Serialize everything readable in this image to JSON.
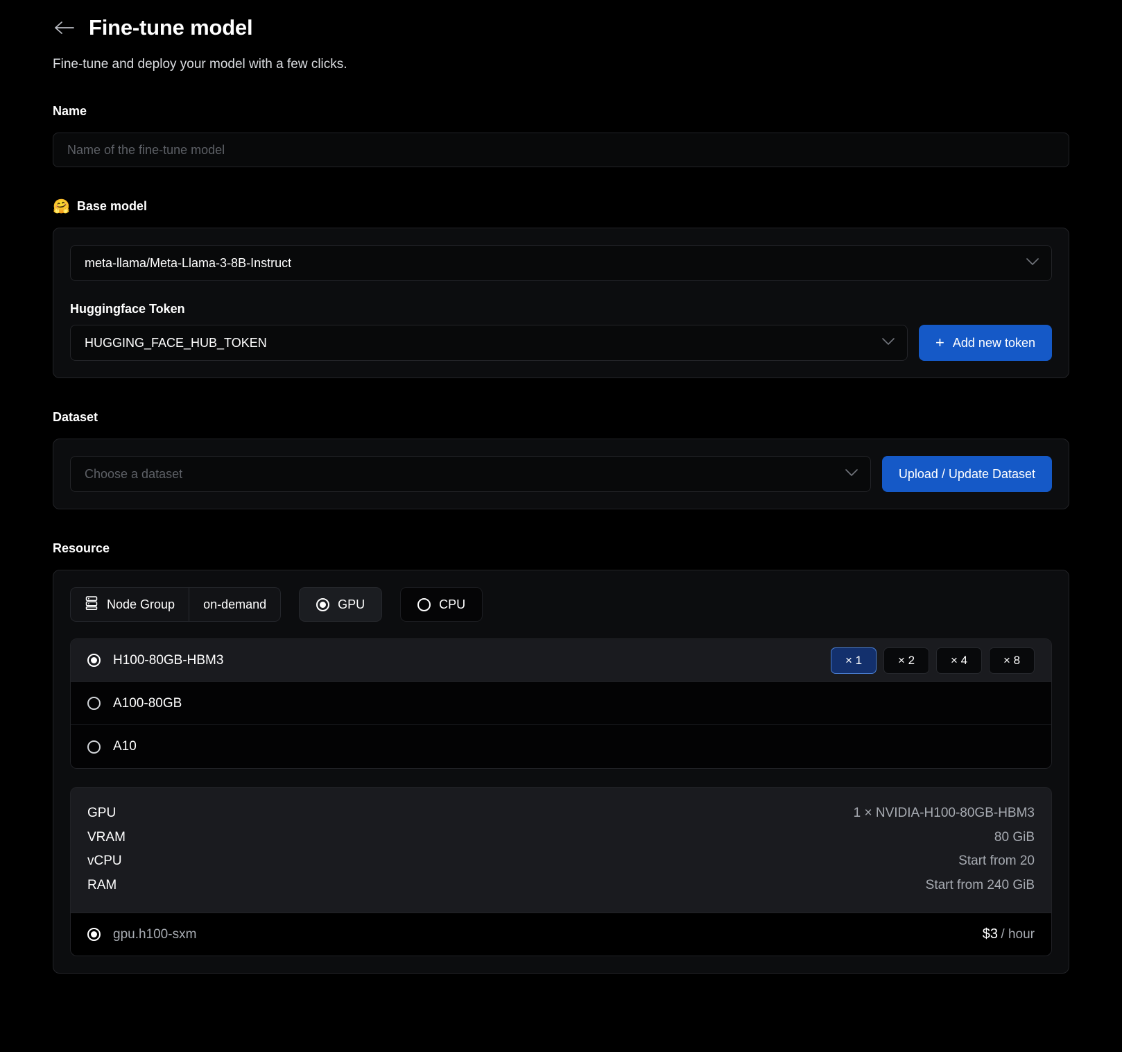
{
  "header": {
    "back_icon": "arrow-left-icon",
    "title": "Fine-tune model",
    "subtitle": "Fine-tune and deploy your model with a few clicks."
  },
  "name_section": {
    "label": "Name",
    "placeholder": "Name of the fine-tune model",
    "value": ""
  },
  "base_model": {
    "emoji": "🤗",
    "label": "Base model",
    "model_select": {
      "value": "meta-llama/Meta-Llama-3-8B-Instruct",
      "chevron": "chevron-down-icon"
    },
    "token": {
      "label": "Huggingface Token",
      "value": "HUGGING_FACE_HUB_TOKEN",
      "chevron": "chevron-down-icon",
      "add_button": "Add new token",
      "add_button_icon": "plus-icon"
    }
  },
  "dataset": {
    "label": "Dataset",
    "select_placeholder": "Choose a dataset",
    "chevron": "chevron-down-icon",
    "upload_button": "Upload / Update Dataset"
  },
  "resource": {
    "label": "Resource",
    "node_group": {
      "icon": "server-stack-icon",
      "label": "Node Group",
      "value": "on-demand"
    },
    "compute_toggles": [
      {
        "label": "GPU",
        "selected": true
      },
      {
        "label": "CPU",
        "selected": false
      }
    ],
    "gpu_options": [
      {
        "label": "H100-80GB-HBM3",
        "selected": true,
        "multipliers": [
          {
            "label": "× 1",
            "active": true
          },
          {
            "label": "× 2",
            "active": false
          },
          {
            "label": "× 4",
            "active": false
          },
          {
            "label": "× 8",
            "active": false
          }
        ]
      },
      {
        "label": "A100-80GB",
        "selected": false,
        "multipliers": []
      },
      {
        "label": "A10",
        "selected": false,
        "multipliers": []
      }
    ],
    "specs": [
      {
        "key": "GPU",
        "value": "1 × NVIDIA-H100-80GB-HBM3"
      },
      {
        "key": "VRAM",
        "value": "80 GiB"
      },
      {
        "key": "vCPU",
        "value": "Start from 20"
      },
      {
        "key": "RAM",
        "value": "Start from 240 GiB"
      }
    ],
    "instance": {
      "name": "gpu.h100-sxm",
      "selected": true,
      "price_amount": "$3",
      "price_unit": "/ hour"
    }
  },
  "colors": {
    "accent_blue": "#1559c7",
    "selected_mult_bg": "#13306b",
    "selected_mult_border": "#4a7fd4",
    "page_bg": "#000000",
    "panel_bg": "#0c0d0f"
  }
}
